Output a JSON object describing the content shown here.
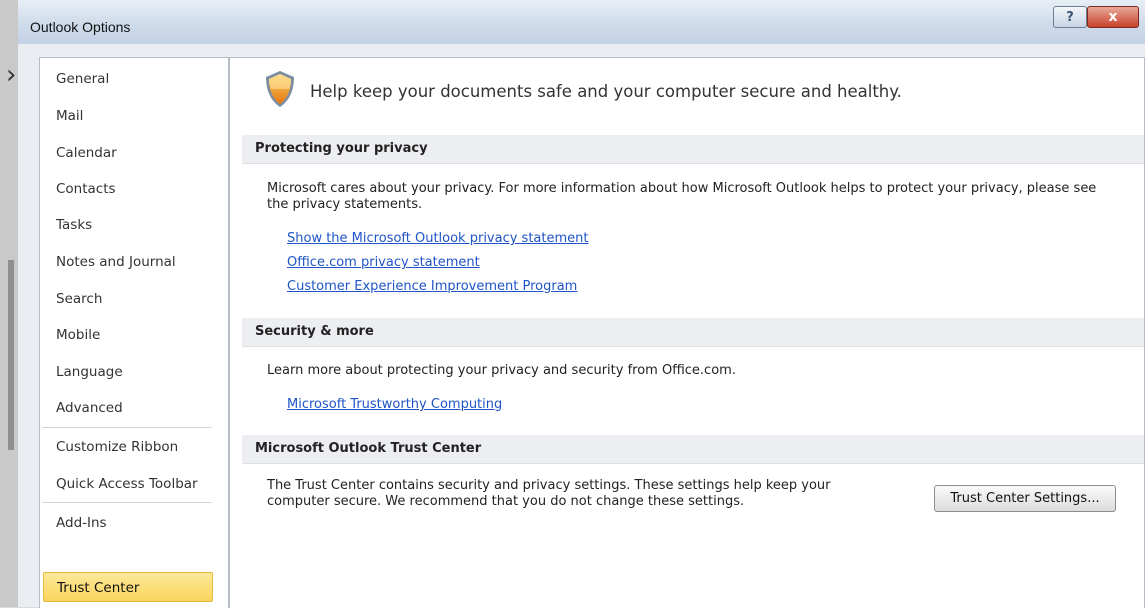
{
  "window": {
    "title": "Outlook Options",
    "help_label": "?",
    "close_label": "x"
  },
  "nav": {
    "items": [
      {
        "label": "General"
      },
      {
        "label": "Mail"
      },
      {
        "label": "Calendar"
      },
      {
        "label": "Contacts"
      },
      {
        "label": "Tasks"
      },
      {
        "label": "Notes and Journal"
      },
      {
        "label": "Search"
      },
      {
        "label": "Mobile"
      },
      {
        "label": "Language"
      },
      {
        "label": "Advanced"
      },
      {
        "label": "Customize Ribbon"
      },
      {
        "label": "Quick Access Toolbar"
      },
      {
        "label": "Add-Ins"
      },
      {
        "label": "Trust Center"
      }
    ],
    "selected": "Trust Center"
  },
  "content": {
    "banner": "Help keep your documents safe and your computer secure and healthy.",
    "privacy": {
      "heading": "Protecting your privacy",
      "text": "Microsoft cares about your privacy. For more information about how Microsoft Outlook helps to protect your privacy, please see the privacy statements.",
      "links": [
        "Show the Microsoft Outlook privacy statement",
        "Office.com privacy statement",
        "Customer Experience Improvement Program"
      ]
    },
    "security": {
      "heading": "Security & more",
      "text": "Learn more about protecting your privacy and security from Office.com.",
      "link": "Microsoft Trustworthy Computing"
    },
    "trust_center": {
      "heading": "Microsoft Outlook Trust Center",
      "text": "The Trust Center contains security and privacy settings. These settings help keep your computer secure. We recommend that you do not change these settings.",
      "button_label": "Trust Center Settings..."
    }
  },
  "colors": {
    "link": "#1f54c7",
    "selected_nav": "#fbd55c",
    "section_header": "#eceef1"
  }
}
